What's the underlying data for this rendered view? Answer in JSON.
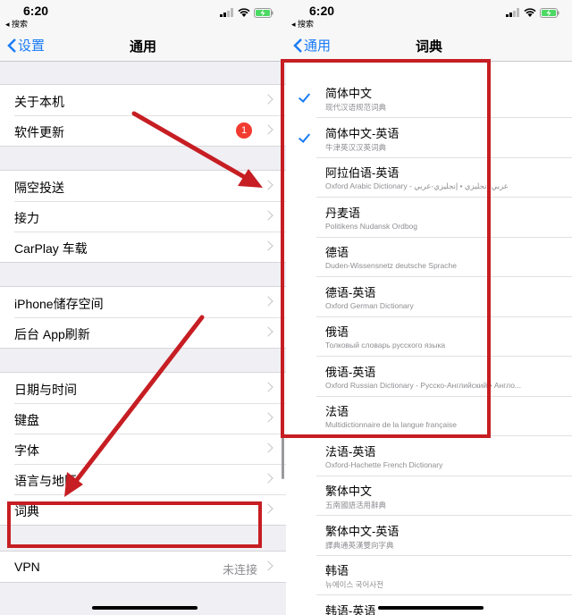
{
  "status": {
    "time": "6:20",
    "back_app": "◂ 搜索"
  },
  "left": {
    "back_label": "设置",
    "title": "通用",
    "groups": [
      {
        "items": [
          {
            "label": "关于本机"
          },
          {
            "label": "软件更新",
            "badge": "1"
          }
        ]
      },
      {
        "items": [
          {
            "label": "隔空投送"
          },
          {
            "label": "接力"
          },
          {
            "label": "CarPlay 车载"
          }
        ]
      },
      {
        "items": [
          {
            "label": "iPhone储存空间"
          },
          {
            "label": "后台 App刷新"
          }
        ]
      },
      {
        "items": [
          {
            "label": "日期与时间"
          },
          {
            "label": "键盘"
          },
          {
            "label": "字体"
          },
          {
            "label": "语言与地区"
          },
          {
            "label": "词典"
          }
        ]
      },
      {
        "items": [
          {
            "label": "VPN",
            "value": "未连接"
          }
        ]
      }
    ]
  },
  "right": {
    "back_label": "通用",
    "title": "词典",
    "dictionaries": [
      {
        "title": "简体中文",
        "subtitle": "现代汉语规范词典",
        "checked": true
      },
      {
        "title": "简体中文-英语",
        "subtitle": "牛津英汉汉英词典",
        "checked": true
      },
      {
        "title": "阿拉伯语-英语",
        "subtitle": "Oxford Arabic Dictionary - عربي-إنجليزي • إنجليزي-عربي",
        "checked": false
      },
      {
        "title": "丹麦语",
        "subtitle": "Politikens Nudansk Ordbog",
        "checked": false
      },
      {
        "title": "德语",
        "subtitle": "Duden-Wissensnetz deutsche Sprache",
        "checked": false
      },
      {
        "title": "德语-英语",
        "subtitle": "Oxford German Dictionary",
        "checked": false
      },
      {
        "title": "俄语",
        "subtitle": "Толковый словарь русского языка",
        "checked": false
      },
      {
        "title": "俄语-英语",
        "subtitle": "Oxford Russian Dictionary - Русско-Английский • Англо...",
        "checked": false
      },
      {
        "title": "法语",
        "subtitle": "Multidictionnaire de la langue française",
        "checked": false
      },
      {
        "title": "法语-英语",
        "subtitle": "Oxford-Hachette French Dictionary",
        "checked": false
      },
      {
        "title": "繁体中文",
        "subtitle": "五南國語活用辭典",
        "checked": false
      },
      {
        "title": "繁体中文-英语",
        "subtitle": "譯典通英漢雙向字典",
        "checked": false
      },
      {
        "title": "韩语",
        "subtitle": "뉴에이스 국어사전",
        "checked": false
      },
      {
        "title": "韩语-英语",
        "subtitle": "",
        "checked": false
      }
    ]
  },
  "colors": {
    "accent": "#1a7cf5",
    "badge": "#f23b30",
    "annotation": "#c61e23",
    "battery": "#4cd964"
  },
  "icons": [
    "chevron-left-icon",
    "chevron-right-icon",
    "checkmark-icon",
    "signal-icon",
    "wifi-icon",
    "battery-charging-icon"
  ]
}
